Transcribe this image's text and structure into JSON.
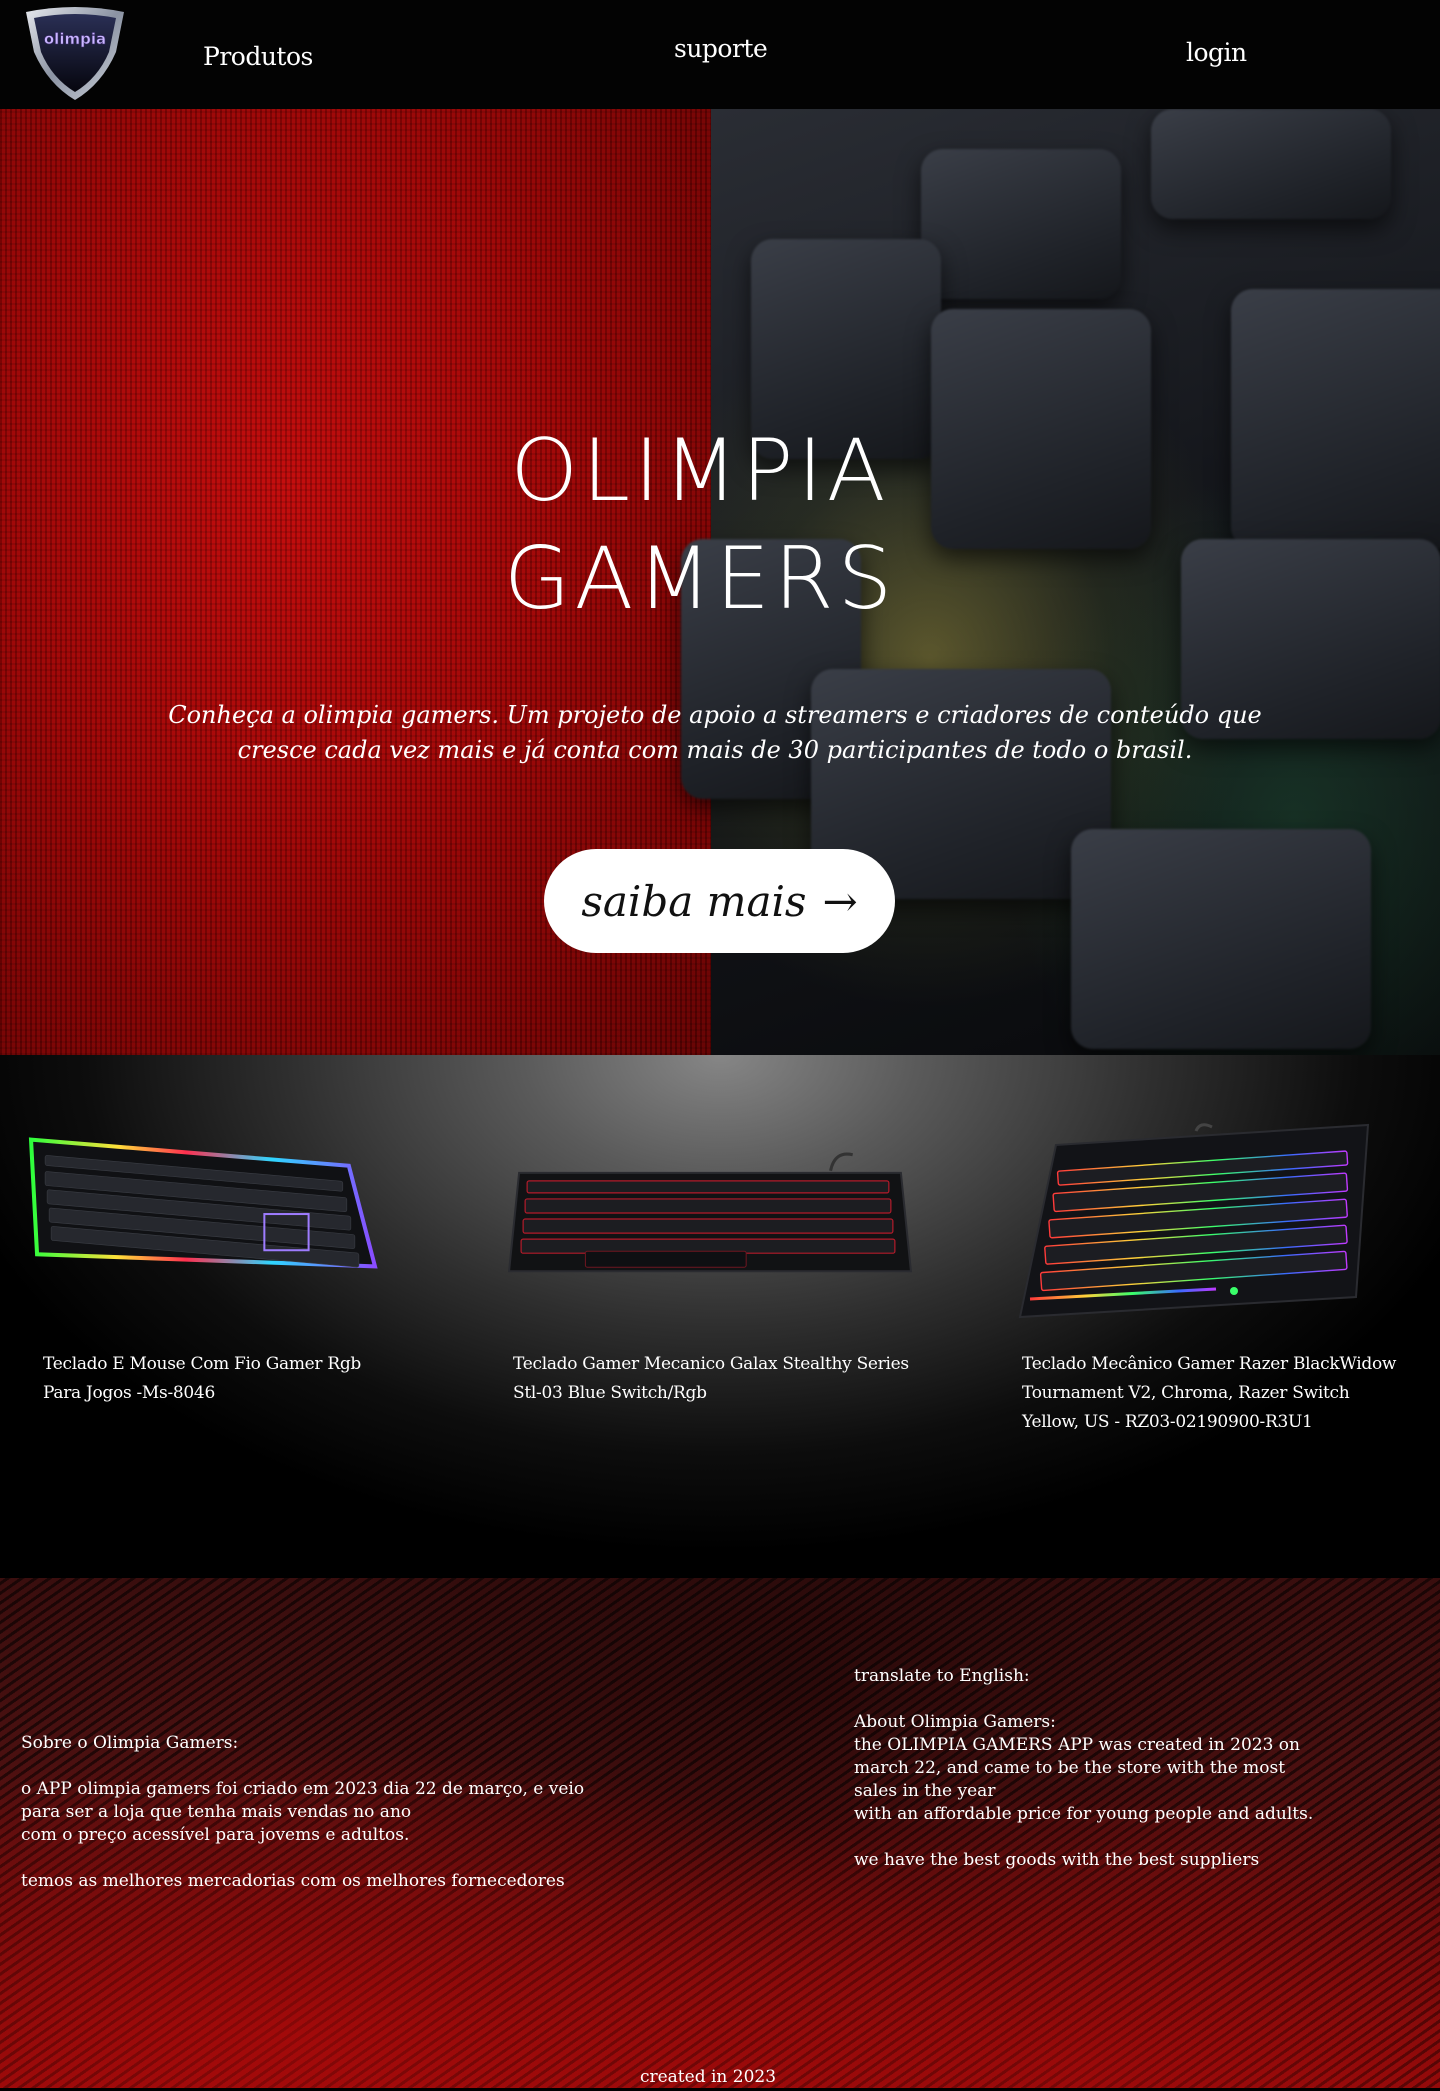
{
  "nav": {
    "logo_text": "olimpia",
    "links": [
      "Produtos",
      "suporte",
      "login"
    ]
  },
  "hero": {
    "title_line1": "OLIMPIA",
    "title_line2": "GAMERS",
    "description": "Conheça a olimpia gamers. Um projeto de apoio a streamers e criadores de conteúdo que cresce cada vez mais e já conta com mais de 30 participantes de todo o brasil.",
    "button_label": "saiba mais",
    "button_arrow": "→"
  },
  "products": [
    {
      "name": "Teclado E Mouse Com Fio Gamer Rgb Para Jogos -Ms-8046",
      "image_icon": "rgb-keyboard-icon"
    },
    {
      "name": "Teclado Gamer Mecanico Galax Stealthy Series Stl-03 Blue Switch/Rgb",
      "image_icon": "red-backlit-keyboard-icon"
    },
    {
      "name": "Teclado Mecânico Gamer Razer BlackWidow Tournament V2, Chroma, Razer Switch Yellow, US - RZ03-02190900-R3U1",
      "image_icon": "chroma-keyboard-icon"
    }
  ],
  "footer": {
    "about_pt": "Sobre o Olimpia Gamers:\n\n  o APP olimpia gamers foi criado em 2023 dia 22 de março, e veio\npara ser a loja que tenha mais vendas no ano\ncom o preço acessível para jovems e adultos.\n\ntemos as melhores mercadorias com os melhores fornecedores",
    "about_en": "translate to English:\n\nAbout Olimpia Gamers:\n  the OLIMPIA GAMERS APP was created in 2023 on march 22, and came to be the store with the most sales in the year\nwith an affordable price for young people and adults.\n\nwe have the best goods with the best suppliers",
    "credit": "created in 2023"
  },
  "colors": {
    "hero_red": "#a50808",
    "footer_red": "#8f0a0a",
    "nav_bg": "#030303"
  }
}
